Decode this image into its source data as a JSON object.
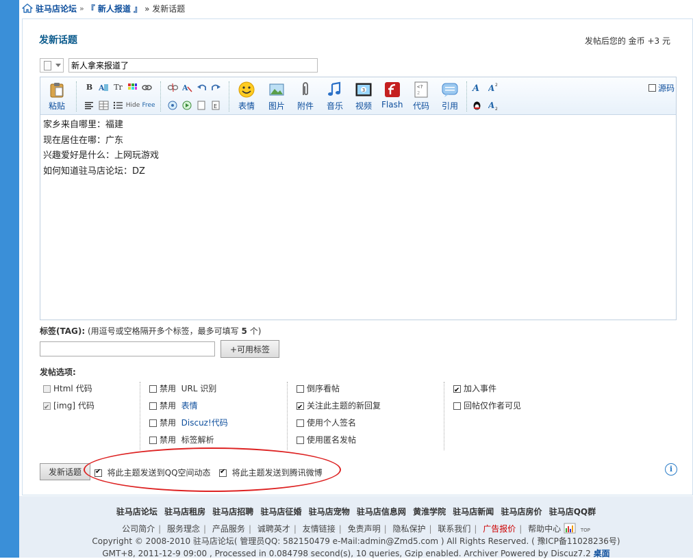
{
  "breadcrumb": {
    "home": "驻马店论坛",
    "sep": "»",
    "forum": "『 新人报道 』",
    "current": "» 发新话题"
  },
  "header": {
    "title": "发新话题",
    "credit_note": "发帖后您的 金币 +3 元"
  },
  "subject": {
    "value": "新人拿来报道了"
  },
  "toolbar": {
    "paste": "粘贴",
    "emoticon": "表情",
    "image": "图片",
    "attachment": "附件",
    "music": "音乐",
    "video": "视频",
    "flash": "Flash",
    "code": "代码",
    "quote": "引用",
    "source": "源码",
    "small": {
      "bold": "B",
      "font_size": "Tr",
      "hide": "Hide",
      "free": "Free"
    }
  },
  "content": {
    "lines": [
      "家乡来自哪里：福建",
      "现在居住在哪：广东",
      "兴趣爱好是什么：上网玩游戏",
      "如何知道驻马店论坛：DZ"
    ]
  },
  "tag": {
    "label": "标签(TAG):",
    "hint_prefix": "(用逗号或空格隔开多个标签，最多可填写",
    "hint_count": "5",
    "hint_suffix": "个)",
    "button": "+可用标签"
  },
  "options": {
    "label": "发帖选项:",
    "col1": {
      "html": "Html 代码",
      "img": "[img] 代码"
    },
    "col2": {
      "disable": "禁用",
      "url": "URL 识别",
      "smilies": "表情",
      "discuz": "Discuz!代码",
      "tags": "标签解析"
    },
    "col3": {
      "reverse": "倒序看帖",
      "follow": "关注此主题的新回复",
      "sig": "使用个人签名",
      "anon": "使用匿名发帖"
    },
    "col4": {
      "event": "加入事件",
      "reply_author": "回帖仅作者可见"
    }
  },
  "submit": {
    "label": "发新话题",
    "share_qzone": "将此主题发送到QQ空间动态",
    "share_weibo": "将此主题发送到腾讯微博"
  },
  "footer": {
    "links": [
      "驻马店论坛",
      "驻马店租房",
      "驻马店招聘",
      "驻马店征婚",
      "驻马店宠物",
      "驻马店信息网",
      "黄淮学院",
      "驻马店新闻",
      "驻马店房价",
      "驻马店QQ群"
    ],
    "nav": [
      "公司简介",
      "服务理念",
      "产品服务",
      "诚聘英才",
      "友情链接",
      "免责声明",
      "隐私保护",
      "联系我们",
      "广告报价",
      "帮助中心"
    ],
    "nav_sep": "|",
    "top": "TOP",
    "copyright": "Copyright © 2008-2010 驻马店论坛( 管理员QQ: 582150479 e-Mail:admin@Zmd5.com ) All Rights Reserved. ( 豫ICP备11028236号)",
    "processed": "GMT+8, 2011-12-9 09:00 , Processed in 0.084798 second(s), 10 queries, Gzip enabled.   Archiver Powered by Discuz7.2",
    "desktop": "桌面"
  },
  "colors": {
    "accent": "#0d4e9c",
    "left_bar": "#3a8fd8",
    "highlight": "#cc0000",
    "annotation": "#dd2222"
  }
}
